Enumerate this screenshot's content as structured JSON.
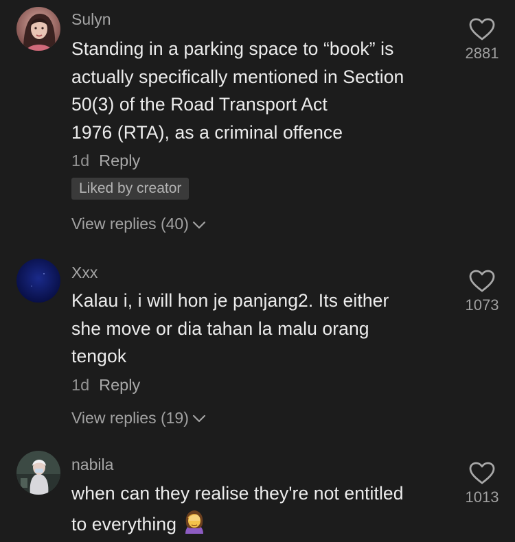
{
  "comments": [
    {
      "username": "Sulyn",
      "text": "Standing in a parking space to “book” is\nactually specifically mentioned in Section\n50(3) of the Road Transport Act\n1976 (RTA), as a criminal offence",
      "time": "1d",
      "reply_label": "Reply",
      "badge": "Liked by creator",
      "view_replies": "View replies (40)",
      "likes": "2881",
      "avatar_icon": "profile-photo-woman"
    },
    {
      "username": "Xxx",
      "text": "Kalau i, i will hon je panjang2. Its either\nshe move or dia tahan la malu orang\ntengok",
      "time": "1d",
      "reply_label": "Reply",
      "view_replies": "View replies (19)",
      "likes": "1073",
      "avatar_icon": "profile-photo-dark-blue"
    },
    {
      "username": "nabila",
      "text_line1": "when can they realise they're not entitled",
      "text_line2": "to everything",
      "emoji": "face-palm-woman-emoji",
      "likes": "1013",
      "avatar_icon": "profile-photo-person"
    }
  ],
  "colors": {
    "background": "#1c1c1c",
    "text": "#ececec",
    "secondary": "#a6a6a6",
    "badge_bg": "#3a3a3a"
  }
}
